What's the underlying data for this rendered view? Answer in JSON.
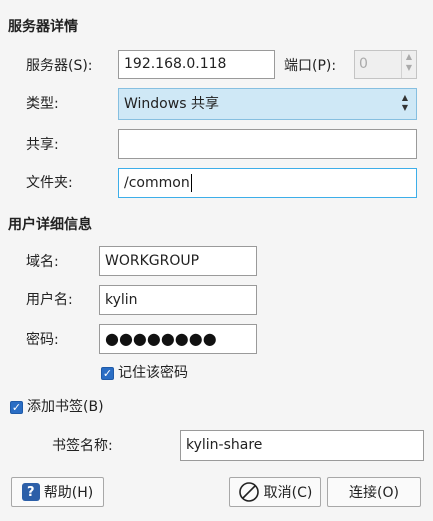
{
  "server_section": {
    "title": "服务器详情",
    "server_label": "服务器(S):",
    "server_value": "192.168.0.118",
    "port_label": "端口(P):",
    "port_value": "0",
    "type_label": "类型:",
    "type_value": "Windows 共享",
    "share_label": "共享:",
    "share_value": "",
    "folder_label": "文件夹:",
    "folder_value": "/common"
  },
  "user_section": {
    "title": "用户详细信息",
    "domain_label": "域名:",
    "domain_value": "WORKGROUP",
    "username_label": "用户名:",
    "username_value": "kylin",
    "password_label": "密码:",
    "password_value": "●●●●●●●●",
    "remember_label": "记住该密码",
    "remember_checked": true
  },
  "bookmark": {
    "add_label": "添加书签(B)",
    "add_checked": true,
    "name_label": "书签名称:",
    "name_value": "kylin-share"
  },
  "buttons": {
    "help_label": "帮助(H)",
    "cancel_label": "取消(C)",
    "connect_label": "连接(O)"
  },
  "icons": {
    "help": "help-icon",
    "cancel": "cancel-icon",
    "check": "checkmark-icon"
  }
}
